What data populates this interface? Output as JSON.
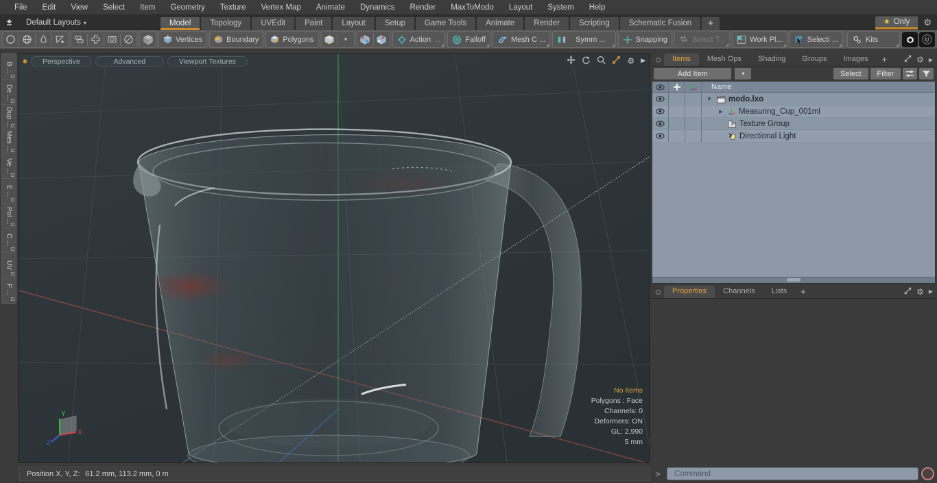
{
  "menubar": {
    "items": [
      "File",
      "Edit",
      "View",
      "Select",
      "Item",
      "Geometry",
      "Texture",
      "Vertex Map",
      "Animate",
      "Dynamics",
      "Render",
      "MaxToModo",
      "Layout",
      "System",
      "Help"
    ]
  },
  "layoutbar": {
    "home_icon": "home-up-icon",
    "layouts_label": "Default Layouts",
    "caret": "▾",
    "tabs": [
      {
        "label": "Model",
        "active": true
      },
      {
        "label": "Topology",
        "active": false
      },
      {
        "label": "UVEdit",
        "active": false
      },
      {
        "label": "Paint",
        "active": false
      },
      {
        "label": "Layout",
        "active": false
      },
      {
        "label": "Setup",
        "active": false
      },
      {
        "label": "Game Tools",
        "active": false
      },
      {
        "label": "Animate",
        "active": false
      },
      {
        "label": "Render",
        "active": false
      },
      {
        "label": "Scripting",
        "active": false
      },
      {
        "label": "Schematic Fusion",
        "active": false
      }
    ],
    "add_tab_label": "+",
    "only_label": "Only",
    "only_star": "★",
    "gear_icon": "gear-icon",
    "accent_color": "#d08a2a"
  },
  "toolbar": {
    "shape_tools": [
      "circle-icon",
      "globe-icon",
      "pen-icon",
      "curve-icon"
    ],
    "snap_tools": [
      "align-icon",
      "center-icon",
      "box-select-icon",
      "radial-icon"
    ],
    "cube_tool": "cube-icon",
    "selection_modes": [
      {
        "label": "Vertices",
        "icon": "vertices-cube-icon"
      },
      {
        "label": "Boundary",
        "icon": "boundary-cube-icon"
      },
      {
        "label": "Polygons",
        "icon": "polygons-cube-icon"
      }
    ],
    "item_mode_icon": "item-cube-icon",
    "item_mode_caret": "▾",
    "pivot_icons": [
      "pivot-center-icon",
      "pivot-origin-icon"
    ],
    "action_label": "Action",
    "action_ellipsis": "...",
    "falloff_label": "Falloff",
    "mesh_constraint_label": "Mesh C ...",
    "symmetry_label": "Symm ...",
    "snapping_label": "Snapping",
    "select_through_label": "Select T...",
    "work_plane_label": "Work Pl...",
    "selection_label": "Selecti ...",
    "kits_label": "Kits",
    "modo_badge": "modo-icon",
    "unreal_badge": "unreal-icon"
  },
  "left_strip": {
    "tabs": [
      "B ...",
      "De ...",
      "Dup ...",
      "Mes ...",
      "Ve ...",
      "E ...",
      "Pol ...",
      "C ...",
      "UV",
      "F ..."
    ]
  },
  "viewport": {
    "dot_color": "#d4a03a",
    "chips": [
      "Perspective",
      "Advanced",
      "Viewport Textures"
    ],
    "tools": [
      "move-icon",
      "rotate-icon",
      "zoom-icon",
      "fit-icon",
      "gear-icon",
      "expand-arrow-icon"
    ],
    "stats": {
      "selection": "No Items",
      "polygons": "Polygons : Face",
      "channels": "Channels: 0",
      "deformers": "Deformers: ON",
      "gl": "GL: 2,990",
      "grid": "5 mm"
    },
    "gizmo": {
      "x": "X",
      "y": "Y",
      "z": "Z",
      "x_color": "#c0392b",
      "y_color": "#27c03a",
      "z_color": "#2f57d8"
    },
    "background_color": "#2f363a"
  },
  "items_panel": {
    "tabs": [
      {
        "label": "Items",
        "active": true
      },
      {
        "label": "Mesh Ops",
        "active": false
      },
      {
        "label": "Shading",
        "active": false
      },
      {
        "label": "Groups",
        "active": false
      },
      {
        "label": "Images",
        "active": false
      }
    ],
    "add_tab_label": "+",
    "panel_icons": [
      "expand-icon",
      "gear-icon",
      "chevron-right-icon"
    ],
    "add_item_label": "Add Item",
    "add_item_caret": "▾",
    "select_label": "Select",
    "filter_label": "Filter",
    "list_options_icon": "list-options-icon",
    "filter_funnel_icon": "funnel-icon",
    "columns": [
      "eye-icon",
      "lock-plus-icon",
      "axis-icon",
      "Name"
    ],
    "rows": [
      {
        "name": "modo.lxo",
        "icon": "scene-clapper-icon",
        "depth": 0,
        "bold": true,
        "expander": "▼"
      },
      {
        "name": "Measuring_Cup_001ml",
        "icon": "mesh-axis-icon",
        "depth": 1,
        "bold": false,
        "expander": "▶"
      },
      {
        "name": "Texture Group",
        "icon": "folder-texture-icon",
        "depth": 1,
        "bold": false,
        "expander": ""
      },
      {
        "name": "Directional Light",
        "icon": "light-icon",
        "depth": 1,
        "bold": false,
        "expander": ""
      }
    ]
  },
  "properties_panel": {
    "tabs": [
      {
        "label": "Properties",
        "active": true
      },
      {
        "label": "Channels",
        "active": false
      },
      {
        "label": "Lists",
        "active": false
      }
    ],
    "add_tab_label": "+",
    "panel_icons": [
      "expand-icon",
      "gear-icon",
      "chevron-right-icon"
    ]
  },
  "statusbar": {
    "position_label": "Position X, Y, Z:",
    "position_value": "61.2 mm, 113.2 mm, 0 m",
    "command_prompt": ">",
    "command_placeholder": "Command",
    "record_icon": "record-circle-icon"
  }
}
